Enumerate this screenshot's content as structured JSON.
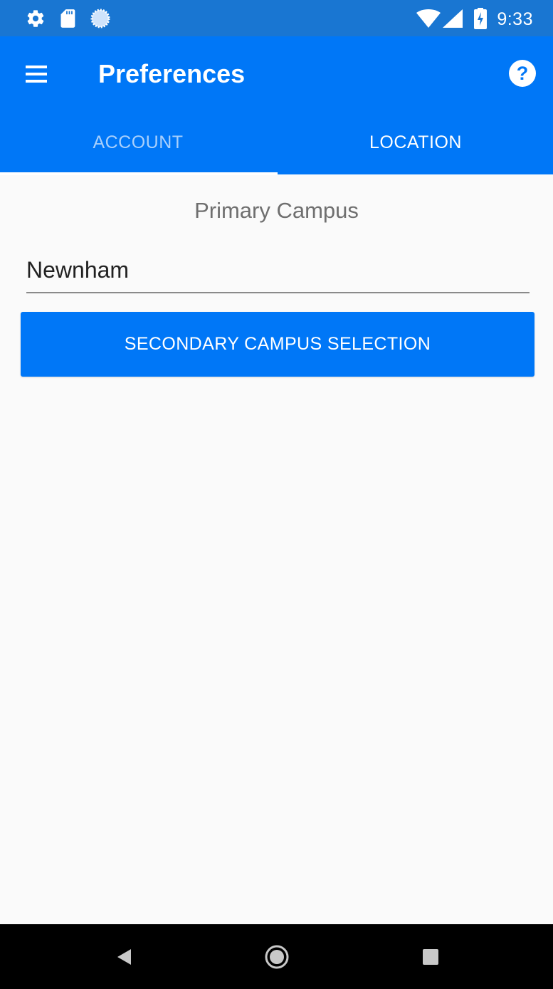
{
  "status_bar": {
    "time": "9:33",
    "left_icons": [
      "gear-icon",
      "sd-card-icon",
      "sync-progress-icon"
    ],
    "right_icons": [
      "wifi-icon",
      "cellular-signal-icon",
      "battery-charging-icon"
    ]
  },
  "app_bar": {
    "title": "Preferences",
    "menu_icon": "hamburger-menu-icon",
    "help_icon": "help-question-icon"
  },
  "tabs": [
    {
      "label": "ACCOUNT",
      "selected": true
    },
    {
      "label": "LOCATION",
      "selected": false
    }
  ],
  "content": {
    "primary_campus_label": "Primary Campus",
    "primary_campus_value": "Newnham",
    "secondary_button_label": "SECONDARY CAMPUS SELECTION"
  },
  "nav_bar": {
    "icons": [
      "back-icon",
      "home-icon",
      "recents-icon"
    ]
  },
  "colors": {
    "status_bar": "#1976d2",
    "primary": "#0077f7",
    "background": "#fafafa",
    "tab_inactive_text": "#a9d0fc"
  }
}
